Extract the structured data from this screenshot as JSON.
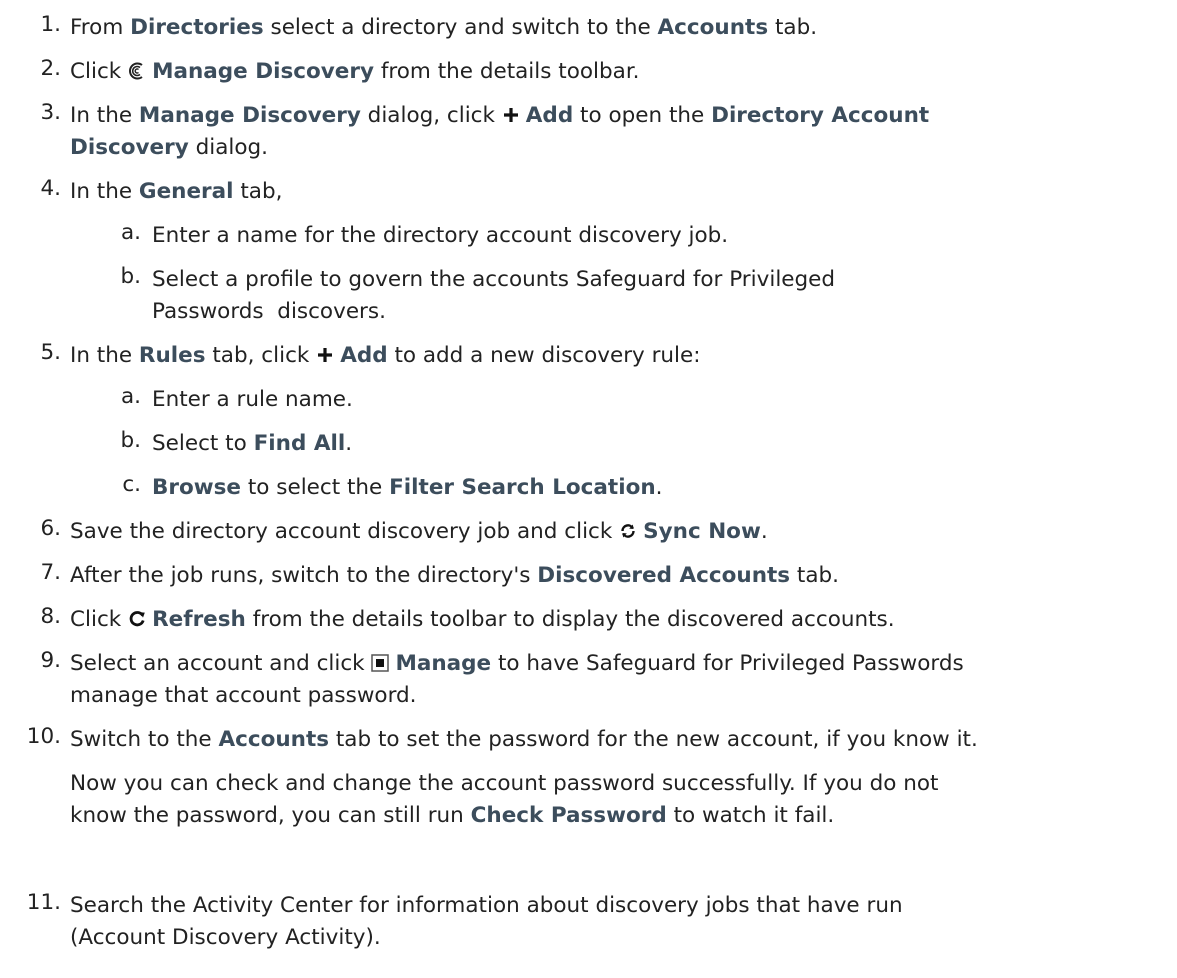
{
  "steps": [
    {
      "n": "1.",
      "p": [
        "From ",
        "Directories",
        " select a directory and switch to the ",
        "Accounts",
        " tab."
      ]
    },
    {
      "n": "2.",
      "p": [
        "Click ",
        "Manage Discovery",
        " from the details toolbar."
      ]
    },
    {
      "n": "3.",
      "p": [
        "In the ",
        "Manage Discovery",
        " dialog, click ",
        "Add",
        " to open the ",
        "Directory Account",
        "Discovery",
        " dialog."
      ]
    },
    {
      "n": "4.",
      "p": [
        "In the ",
        "General",
        " tab,"
      ]
    },
    {
      "n": "5.",
      "p": [
        "In the ",
        "Rules",
        " tab, click ",
        "Add",
        " to add a new discovery rule:"
      ]
    },
    {
      "n": "6.",
      "p": [
        "Save the directory account discovery job and click ",
        "Sync Now",
        "."
      ]
    },
    {
      "n": "7.",
      "p": [
        "After the job runs, switch to the directory's ",
        "Discovered Accounts",
        " tab."
      ]
    },
    {
      "n": "8.",
      "p": [
        "Click ",
        "Refresh",
        " from the details toolbar to display the discovered accounts."
      ]
    },
    {
      "n": "9.",
      "p": [
        "Select an account and click ",
        "Manage",
        " to have Safeguard for Privileged Passwords",
        "manage that account password."
      ]
    },
    {
      "n": "10.",
      "p": [
        "Switch to the ",
        "Accounts",
        " tab to set the password for the new account, if you know it."
      ],
      "note": [
        "Now you can check and change the account password successfully. If you do not",
        "know the password, you can still run ",
        "Check Password",
        " to watch it fail."
      ]
    },
    {
      "n": "11.",
      "p": [
        "Search the Activity Center for information about discovery jobs that have run",
        "(Account Discovery Activity)."
      ]
    }
  ],
  "substeps": {
    "s4": [
      {
        "l": "a.",
        "t": [
          "Enter a name for the directory account discovery job."
        ]
      },
      {
        "l": "b.",
        "t": [
          "Select a profile to govern the accounts Safeguard for Privileged",
          "Passwords  discovers."
        ]
      }
    ],
    "s5": [
      {
        "l": "a.",
        "t": [
          "Enter a rule name."
        ]
      },
      {
        "l": "b.",
        "t": [
          "Select to ",
          "Find All",
          "."
        ]
      },
      {
        "l": "c.",
        "t": [
          "",
          "Browse",
          " to select the ",
          "Filter Search Location",
          "."
        ]
      }
    ]
  },
  "icons": [
    "manage-discovery-icon",
    "add-icon",
    "sync-icon",
    "refresh-icon",
    "manage-icon"
  ],
  "colors": {
    "text": "#222222",
    "bold": "#3c4d5c"
  }
}
